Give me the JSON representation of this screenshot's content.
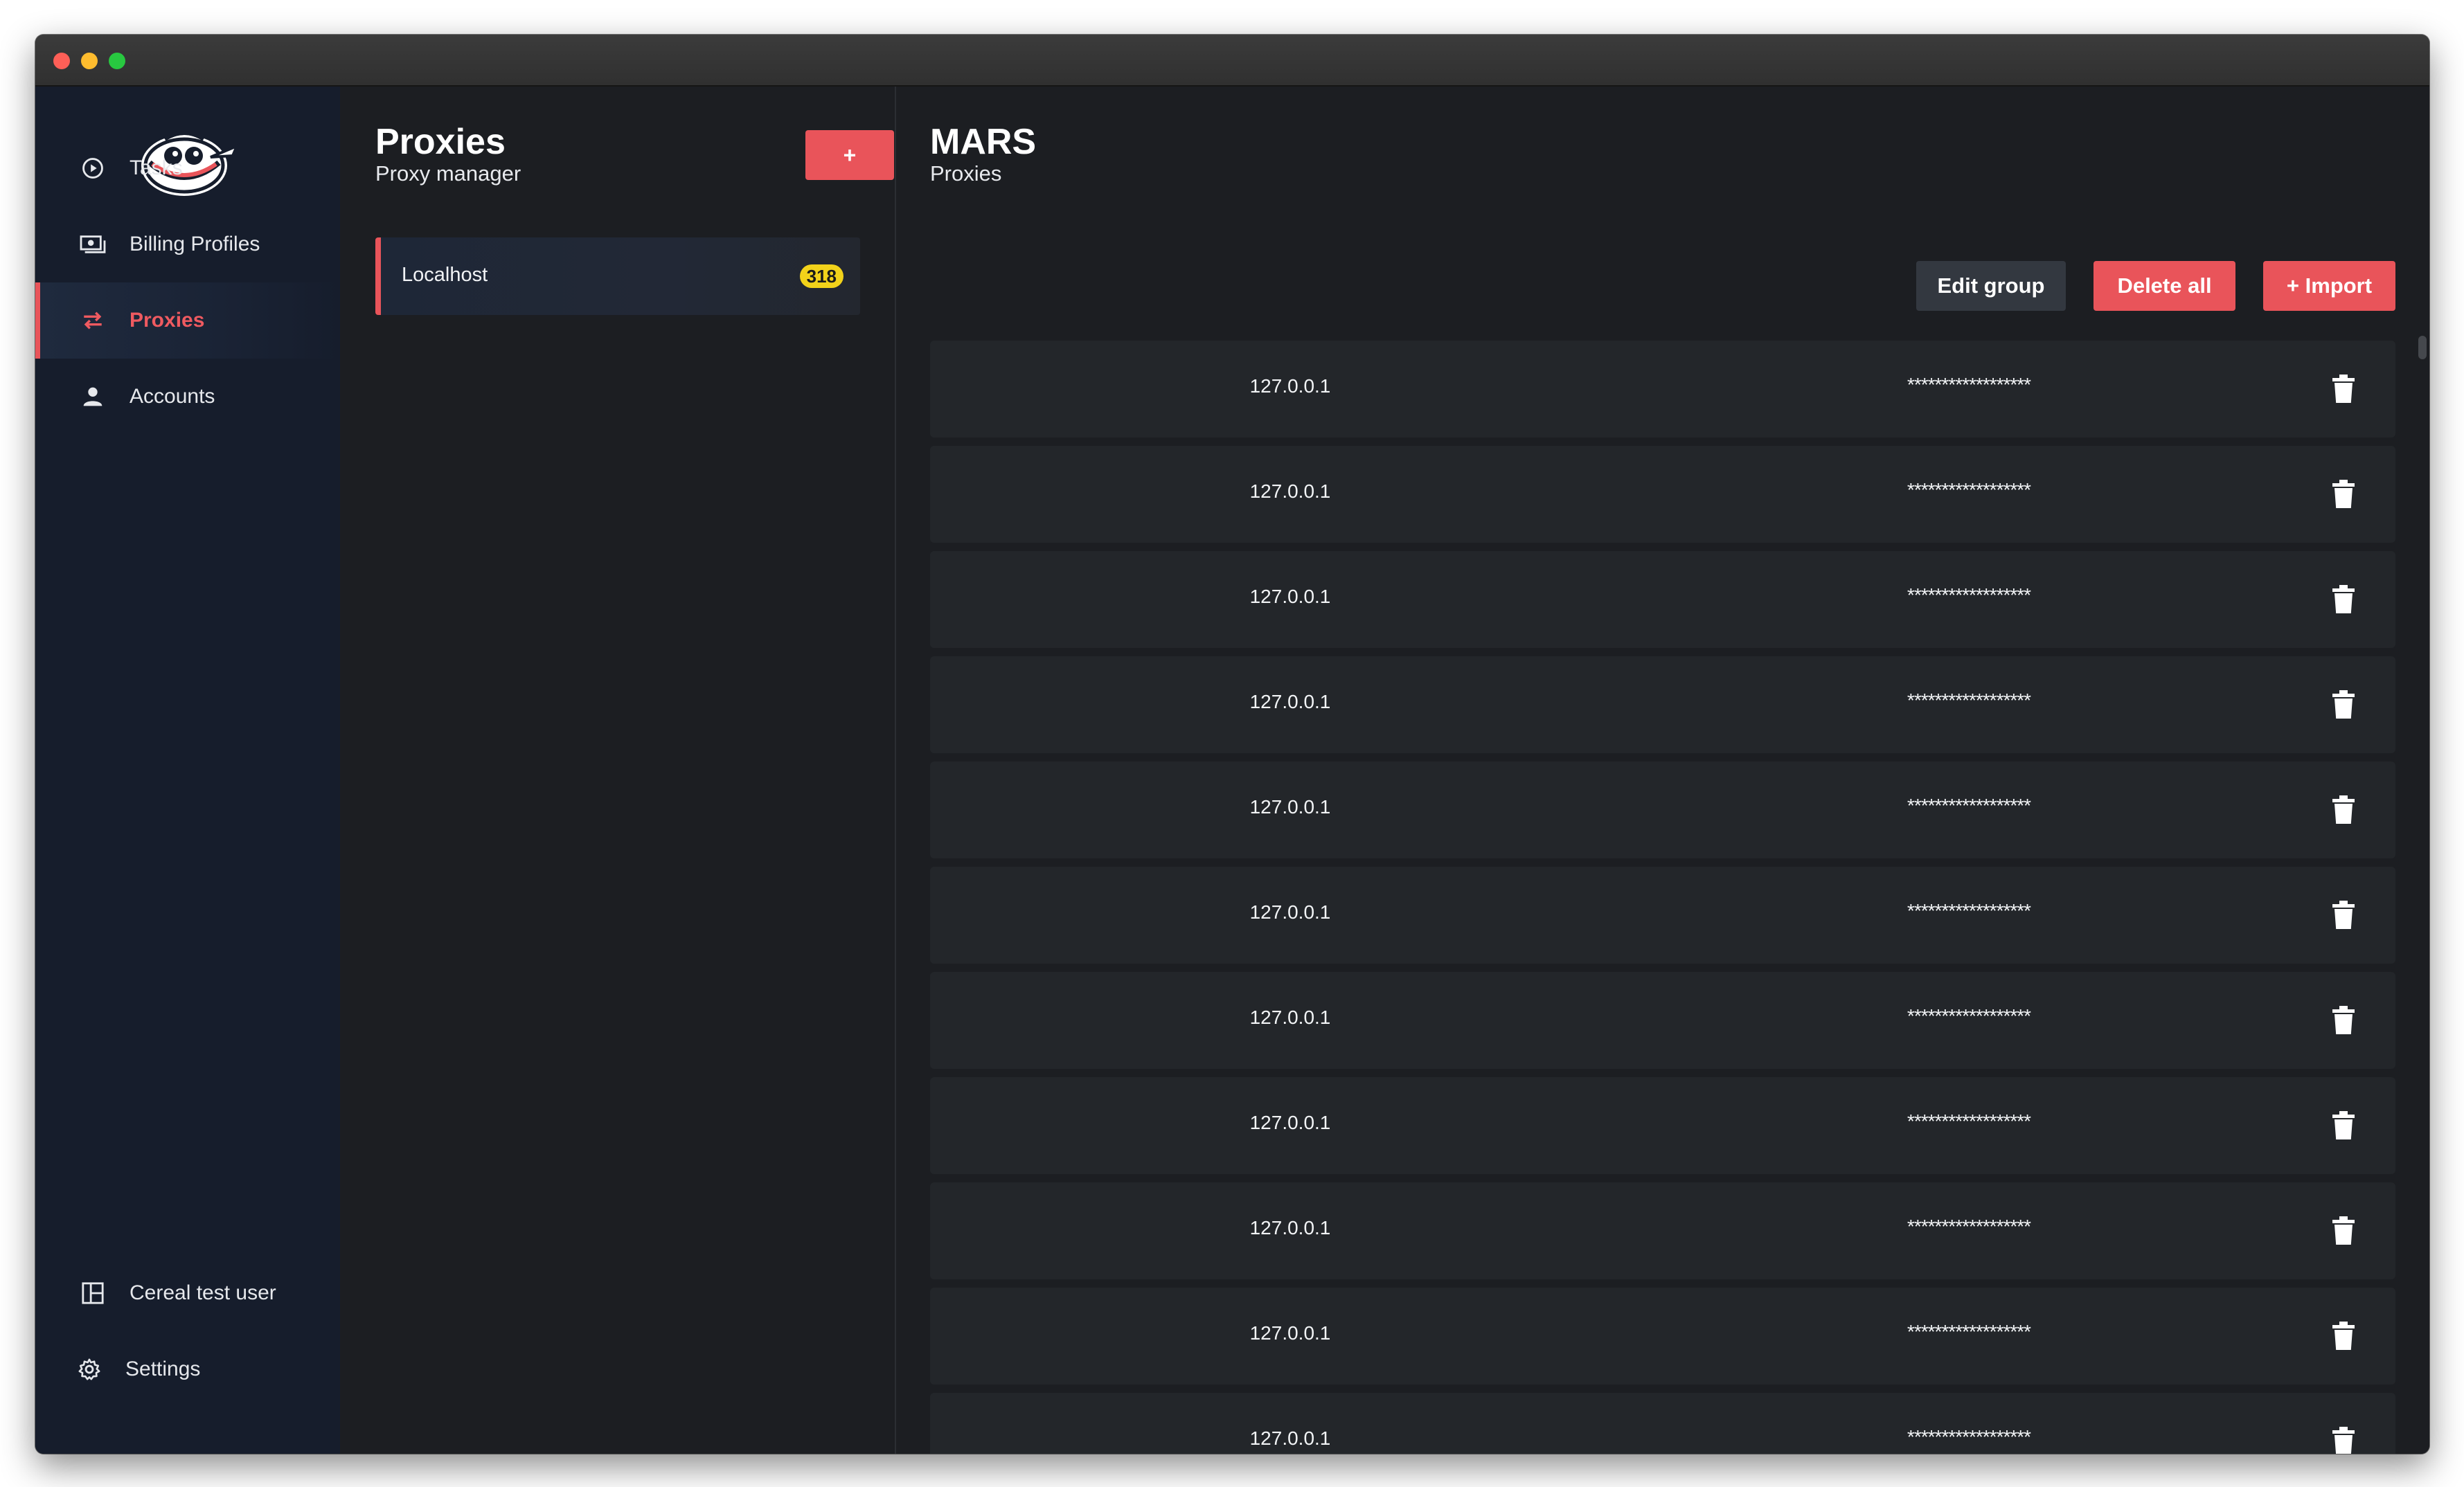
{
  "sidebar": {
    "items": [
      {
        "label": "Tasks",
        "icon": "play-circle-icon"
      },
      {
        "label": "Billing Profiles",
        "icon": "money-icon"
      },
      {
        "label": "Proxies",
        "icon": "swap-arrows-icon",
        "active": true
      },
      {
        "label": "Accounts",
        "icon": "person-icon"
      }
    ],
    "user": {
      "label": "Cereal test user",
      "icon": "dashboard-icon"
    },
    "settings": {
      "label": "Settings",
      "icon": "gear-icon"
    }
  },
  "groups_panel": {
    "title": "Proxies",
    "subtitle": "Proxy manager",
    "add_label": "+",
    "groups": [
      {
        "name": "Localhost",
        "count": "318"
      }
    ]
  },
  "main": {
    "title": "MARS",
    "subtitle": "Proxies",
    "edit_label": "Edit group",
    "delete_all_label": "Delete all",
    "import_label": "+ Import",
    "rows": [
      {
        "ip": "127.0.0.1",
        "password": "******************"
      },
      {
        "ip": "127.0.0.1",
        "password": "******************"
      },
      {
        "ip": "127.0.0.1",
        "password": "******************"
      },
      {
        "ip": "127.0.0.1",
        "password": "******************"
      },
      {
        "ip": "127.0.0.1",
        "password": "******************"
      },
      {
        "ip": "127.0.0.1",
        "password": "******************"
      },
      {
        "ip": "127.0.0.1",
        "password": "******************"
      },
      {
        "ip": "127.0.0.1",
        "password": "******************"
      },
      {
        "ip": "127.0.0.1",
        "password": "******************"
      },
      {
        "ip": "127.0.0.1",
        "password": "******************"
      },
      {
        "ip": "127.0.0.1",
        "password": "******************"
      }
    ]
  },
  "colors": {
    "accent": "#e9545a",
    "badge": "#f2d21a",
    "sidebar": "#161d2c",
    "background": "#1c1e22",
    "row": "#23262a"
  }
}
